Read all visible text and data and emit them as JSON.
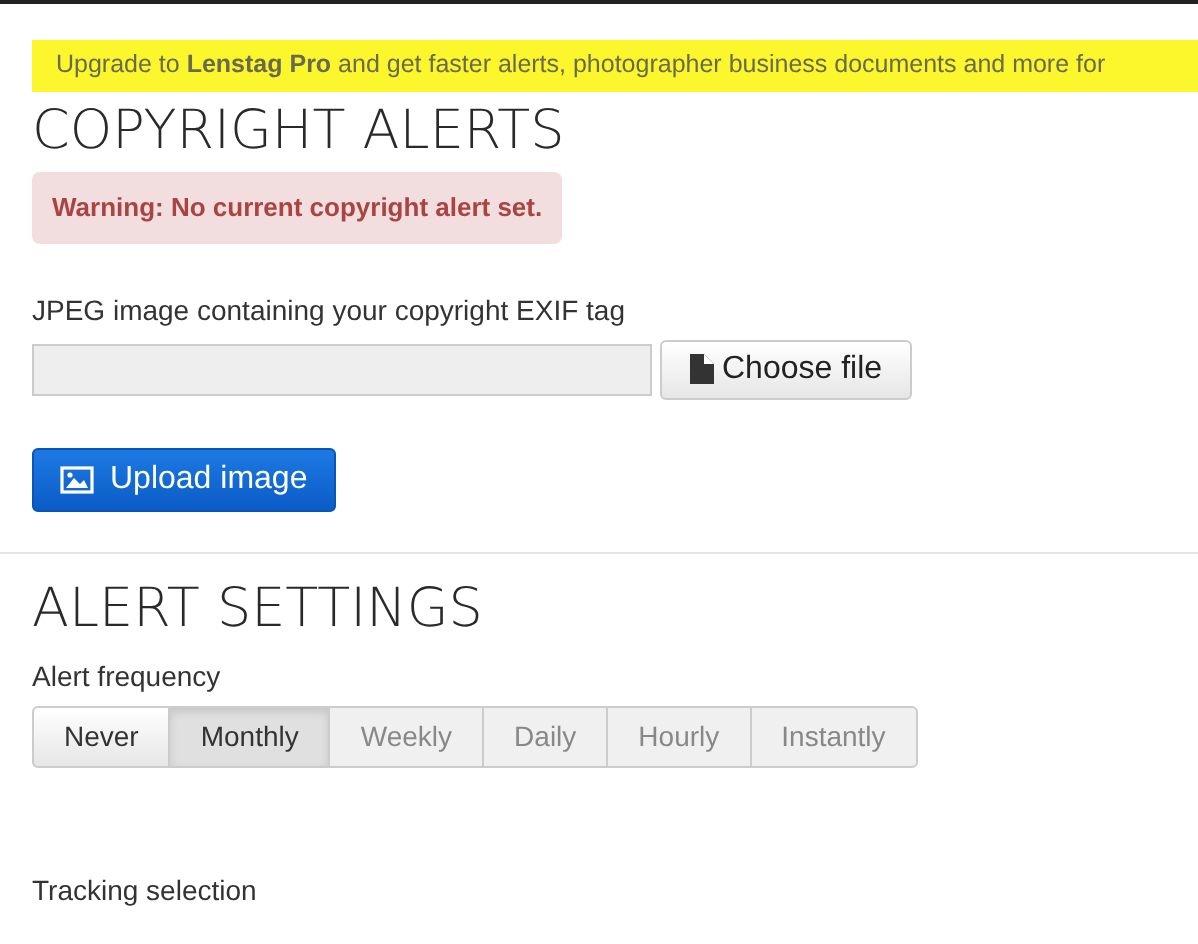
{
  "banner": {
    "text": "Upgrade to **Lenstag Pro** and get faster alerts, photographer business documents and more for"
  },
  "copyright_alerts": {
    "heading": "COPYRIGHT ALERTS",
    "warning": "Warning: No current copyright alert set.",
    "file_label": "JPEG image containing your copyright EXIF tag",
    "choose_button": "Choose file",
    "upload_button": "Upload image"
  },
  "alert_settings": {
    "heading": "ALERT SETTINGS",
    "frequency_label": "Alert frequency",
    "frequencies": [
      {
        "label": "Never",
        "selected": false,
        "disabled": false
      },
      {
        "label": "Monthly",
        "selected": true,
        "disabled": false
      },
      {
        "label": "Weekly",
        "selected": false,
        "disabled": true
      },
      {
        "label": "Daily",
        "selected": false,
        "disabled": true
      },
      {
        "label": "Hourly",
        "selected": false,
        "disabled": true
      },
      {
        "label": "Instantly",
        "selected": false,
        "disabled": true
      }
    ],
    "tracking_label": "Tracking selection"
  }
}
